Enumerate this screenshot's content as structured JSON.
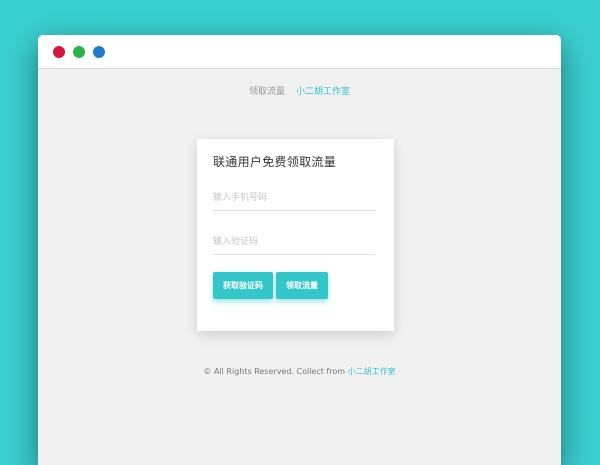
{
  "window": {
    "controls": [
      {
        "name": "close",
        "color": "#d5173f"
      },
      {
        "name": "minimize",
        "color": "#2db14a"
      },
      {
        "name": "maximize",
        "color": "#1a7fc8"
      }
    ]
  },
  "header": {
    "link_muted": "领取流量",
    "link_accent": "小二胡工作室"
  },
  "card": {
    "title": "联通用户免费领取流量",
    "phone_placeholder": "输入手机号码",
    "code_placeholder": "输入验证码",
    "get_code_label": "获取验证码",
    "claim_label": "领取流量"
  },
  "footer": {
    "text": "© All Rights Reserved. Collect from ",
    "link": "小二胡工作室"
  },
  "colors": {
    "background": "#3acfcf",
    "accent": "#33c7c9"
  }
}
